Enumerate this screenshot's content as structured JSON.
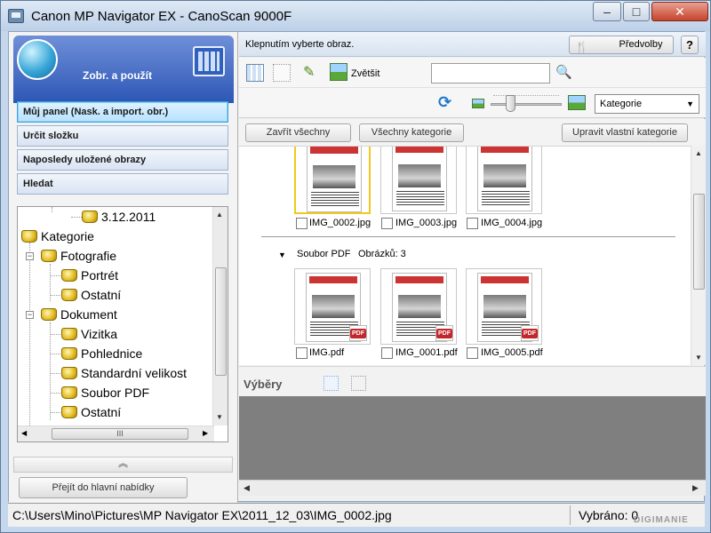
{
  "window": {
    "title": "Canon MP Navigator EX - CanoScan 9000F",
    "min": "–",
    "max": "□",
    "close": "✕"
  },
  "left": {
    "header_title": "Zobr. a použít",
    "nav": [
      {
        "label": "Můj panel (Nask. a import. obr.)",
        "active": true
      },
      {
        "label": "Určit složku"
      },
      {
        "label": "Naposledy uložené obrazy"
      },
      {
        "label": "Hledat"
      }
    ],
    "tree": [
      {
        "label": "3.12.2011",
        "icon": "folder-icon"
      },
      {
        "label": "Kategorie",
        "icon": "folder-icon"
      },
      {
        "label": "Fotografie",
        "icon": "folder-icon"
      },
      {
        "label": "Portrét",
        "icon": "folder-icon"
      },
      {
        "label": "Ostatní",
        "icon": "folder-icon"
      },
      {
        "label": "Dokument",
        "icon": "folder-icon"
      },
      {
        "label": "Vizitka",
        "icon": "folder-icon"
      },
      {
        "label": "Pohlednice",
        "icon": "folder-icon"
      },
      {
        "label": "Standardní velikost",
        "icon": "folder-icon"
      },
      {
        "label": "Soubor PDF",
        "icon": "folder-icon"
      },
      {
        "label": "Ostatní",
        "icon": "folder-icon"
      }
    ],
    "collapse": "︽",
    "main_menu": "Přejít do hlavní nabídky"
  },
  "right": {
    "instruction": "Klepnutím vyberte obraz.",
    "prefs": "Předvolby",
    "help": "?",
    "zoom": "Zvětšit",
    "search_value": "",
    "category_select": "Kategorie",
    "buttons": {
      "close_all": "Zavřít všechny",
      "all_categories": "Všechny kategorie",
      "edit_category": "Upravit vlastní kategorie"
    },
    "top_files": [
      "IMG_0002.jpg",
      "IMG_0003.jpg",
      "IMG_0004.jpg"
    ],
    "group": {
      "name": "Soubor PDF",
      "count_label": "Obrázků: 3"
    },
    "pdf_files": [
      "IMG.pdf",
      "IMG_0001.pdf",
      "IMG_0005.pdf"
    ],
    "pdf_badge": "PDF",
    "selections_label": "Výběry"
  },
  "status": {
    "path": "C:\\Users\\Mino\\Pictures\\MP Navigator EX\\2011_12_03\\IMG_0002.jpg",
    "selected": "Vybráno: 0",
    "watermark": "DIGIMANIE"
  },
  "colors": {
    "accent": "#2d56b5",
    "selection": "#f1c81c",
    "pdf": "#c3262b"
  }
}
